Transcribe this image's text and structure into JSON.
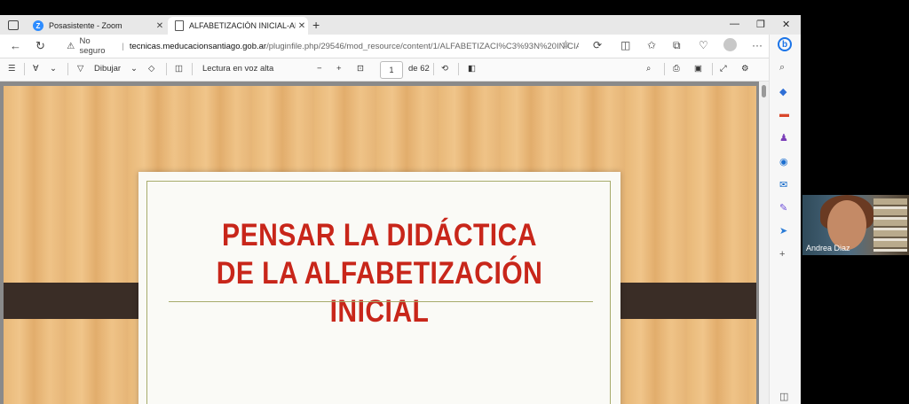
{
  "tabs": [
    {
      "title": "Posasistente - Zoom",
      "icon": "zoom-icon"
    },
    {
      "title": "ALFABETIZACIÓN INICIAL-ABOR",
      "icon": "document-icon"
    }
  ],
  "address": {
    "security_label": "No seguro",
    "host": "tecnicas.meducacionsantiago.gob.ar",
    "path": "/pluginfile.php/29546/mod_resource/content/1/ALFABETIZACI%C3%93N%20INICIAL..."
  },
  "pdf_toolbar": {
    "draw_label": "Dibujar",
    "read_aloud_label": "Lectura en voz alta",
    "page_current": "1",
    "page_total_label": "de 62"
  },
  "slide": {
    "title_lines": [
      "PENSAR LA DIDÁCTICA",
      "DE LA ALFABETIZACIÓN",
      "INICIAL"
    ]
  },
  "participant": {
    "name": "Andrea Diaz"
  },
  "colors": {
    "title_red": "#c8261a",
    "plank": "#3a2d26",
    "wood": "#e8b878"
  }
}
